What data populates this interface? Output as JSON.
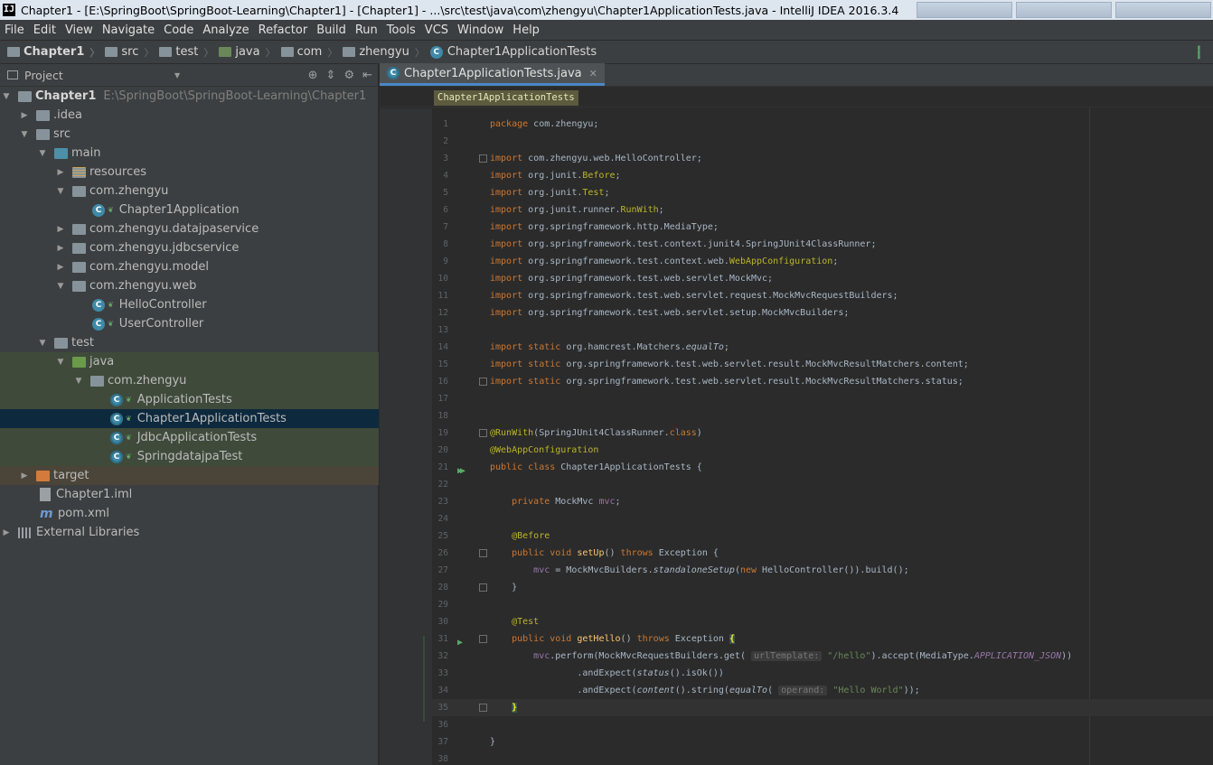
{
  "titlebar": {
    "title": "Chapter1 - [E:\\SpringBoot\\SpringBoot-Learning\\Chapter1] - [Chapter1] - ...\\src\\test\\java\\com\\zhengyu\\Chapter1ApplicationTests.java - IntelliJ IDEA 2016.3.4"
  },
  "menu": [
    "File",
    "Edit",
    "View",
    "Navigate",
    "Code",
    "Analyze",
    "Refactor",
    "Build",
    "Run",
    "Tools",
    "VCS",
    "Window",
    "Help"
  ],
  "breadcrumb": [
    "Chapter1",
    "src",
    "test",
    "java",
    "com",
    "zhengyu",
    "Chapter1ApplicationTests"
  ],
  "project_panel": {
    "title": "Project",
    "tree": [
      {
        "label": "Chapter1",
        "path": "E:\\SpringBoot\\SpringBoot-Learning\\Chapter1"
      },
      {
        "label": ".idea"
      },
      {
        "label": "src"
      },
      {
        "label": "main"
      },
      {
        "label": "resources"
      },
      {
        "label": "com.zhengyu"
      },
      {
        "label": "Chapter1Application"
      },
      {
        "label": "com.zhengyu.datajpaservice"
      },
      {
        "label": "com.zhengyu.jdbcservice"
      },
      {
        "label": "com.zhengyu.model"
      },
      {
        "label": "com.zhengyu.web"
      },
      {
        "label": "HelloController"
      },
      {
        "label": "UserController"
      },
      {
        "label": "test"
      },
      {
        "label": "java"
      },
      {
        "label": "com.zhengyu"
      },
      {
        "label": "ApplicationTests"
      },
      {
        "label": "Chapter1ApplicationTests"
      },
      {
        "label": "JdbcApplicationTests"
      },
      {
        "label": "SpringdatajpaTest"
      },
      {
        "label": "target"
      },
      {
        "label": "Chapter1.iml"
      },
      {
        "label": "pom.xml"
      },
      {
        "label": "External Libraries"
      }
    ]
  },
  "editor": {
    "tab": "Chapter1ApplicationTests.java",
    "class_chip": "Chapter1ApplicationTests",
    "line_numbers": [
      "1",
      "2",
      "3",
      "4",
      "5",
      "6",
      "7",
      "8",
      "9",
      "10",
      "11",
      "12",
      "13",
      "14",
      "15",
      "16",
      "17",
      "18",
      "19",
      "20",
      "21",
      "22",
      "23",
      "24",
      "25",
      "26",
      "27",
      "28",
      "29",
      "30",
      "31",
      "32",
      "33",
      "34",
      "35",
      "36",
      "37",
      "38"
    ],
    "code": {
      "l1": "package com.zhengyu;",
      "l3": "com.zhengyu.web.HelloController;",
      "l4a": "org.junit.",
      "l4b": "Before",
      "l4c": ";",
      "l5a": "org.junit.",
      "l5b": "Test",
      "l5c": ";",
      "l6a": "org.junit.runner.",
      "l6b": "RunWith",
      "l6c": ";",
      "l7": "org.springframework.http.MediaType;",
      "l8": "org.springframework.test.context.junit4.SpringJUnit4ClassRunner;",
      "l9a": "org.springframework.test.context.web.",
      "l9b": "WebAppConfiguration",
      "l9c": ";",
      "l10": "org.springframework.test.web.servlet.MockMvc;",
      "l11": "org.springframework.test.web.servlet.request.MockMvcRequestBuilders;",
      "l12": "org.springframework.test.web.servlet.setup.MockMvcBuilders;",
      "l14a": "org.hamcrest.Matchers.",
      "l14b": "equalTo",
      "l14c": ";",
      "l15": "org.springframework.test.web.servlet.result.MockMvcResultMatchers.content;",
      "l16": "org.springframework.test.web.servlet.result.MockMvcResultMatchers.status;",
      "l19a": "@RunWith",
      "l19b": "(SpringJUnit4ClassRunner.",
      "l19c": "class",
      "l19d": ")",
      "l20": "@WebAppConfiguration",
      "l21": " Chapter1ApplicationTests {",
      "l23a": "MockMvc ",
      "l23b": "mvc",
      "l23c": ";",
      "l25": "@Before",
      "l26a": "setUp",
      "l26b": "() ",
      "l26c": " Exception {",
      "l27a": "mvc",
      "l27b": " = MockMvcBuilders.",
      "l27c": "standaloneSetup",
      "l27d": "(",
      "l27e": " HelloController()).build();",
      "l28": "}",
      "l30": "@Test",
      "l31a": "getHello",
      "l31b": "() ",
      "l31c": " Exception ",
      "l31d": "{",
      "l32a": "mvc",
      "l32b": ".perform(MockMvcRequestBuilders.",
      "l32c": "get",
      "l32d": "( ",
      "l32e": "urlTemplate:",
      "l32f": " \"/hello\"",
      "l32g": ").accept(MediaType.",
      "l32h": "APPLICATION_JSON",
      "l32i": "))",
      "l33a": ".andExpect(",
      "l33b": "status",
      "l33c": "().isOk())",
      "l34a": ".andExpect(",
      "l34b": "content",
      "l34c": "().string(",
      "l34d": "equalTo",
      "l34e": "( ",
      "l34f": "operand:",
      "l34g": " \"Hello World\"",
      "l34h": "));",
      "l35": "}",
      "l37": "}"
    },
    "keywords": {
      "import": "import",
      "static": "static",
      "public": "public",
      "class": "class",
      "private": "private",
      "void": "void",
      "throws": "throws",
      "new": "new"
    }
  }
}
